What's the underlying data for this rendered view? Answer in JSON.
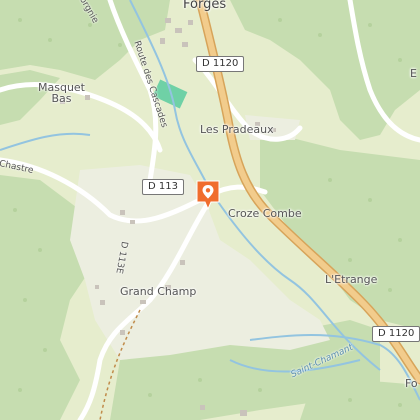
{
  "map": {
    "places": {
      "forges": "Forgès",
      "masquet_bas": "Masquet\nBas",
      "les_pradeaux": "Les Pradeaux",
      "croze_combe": "Croze Combe",
      "letrange": "L'Etrange",
      "grand_champ": "Grand Champ",
      "chastre": "Chastre",
      "partial_top_left": "orgnie",
      "partial_right_top": "E",
      "partial_right_bottom": "Fo"
    },
    "roads": {
      "d1120_top": "D 1120",
      "d1120_bottom": "D 1120",
      "d113": "D 113",
      "d113e": "D 113E",
      "route_des_cascades": "Route des Cascades"
    },
    "water": {
      "saint_chamant": "Saint-Chamant"
    },
    "marker": {
      "icon": "map-pin-icon",
      "color": "#f06d2d"
    },
    "colors": {
      "forest": "#c4dcaa",
      "meadow": "#e4ecc8",
      "major_road": "#f0c987",
      "river": "#8fc3df"
    }
  }
}
